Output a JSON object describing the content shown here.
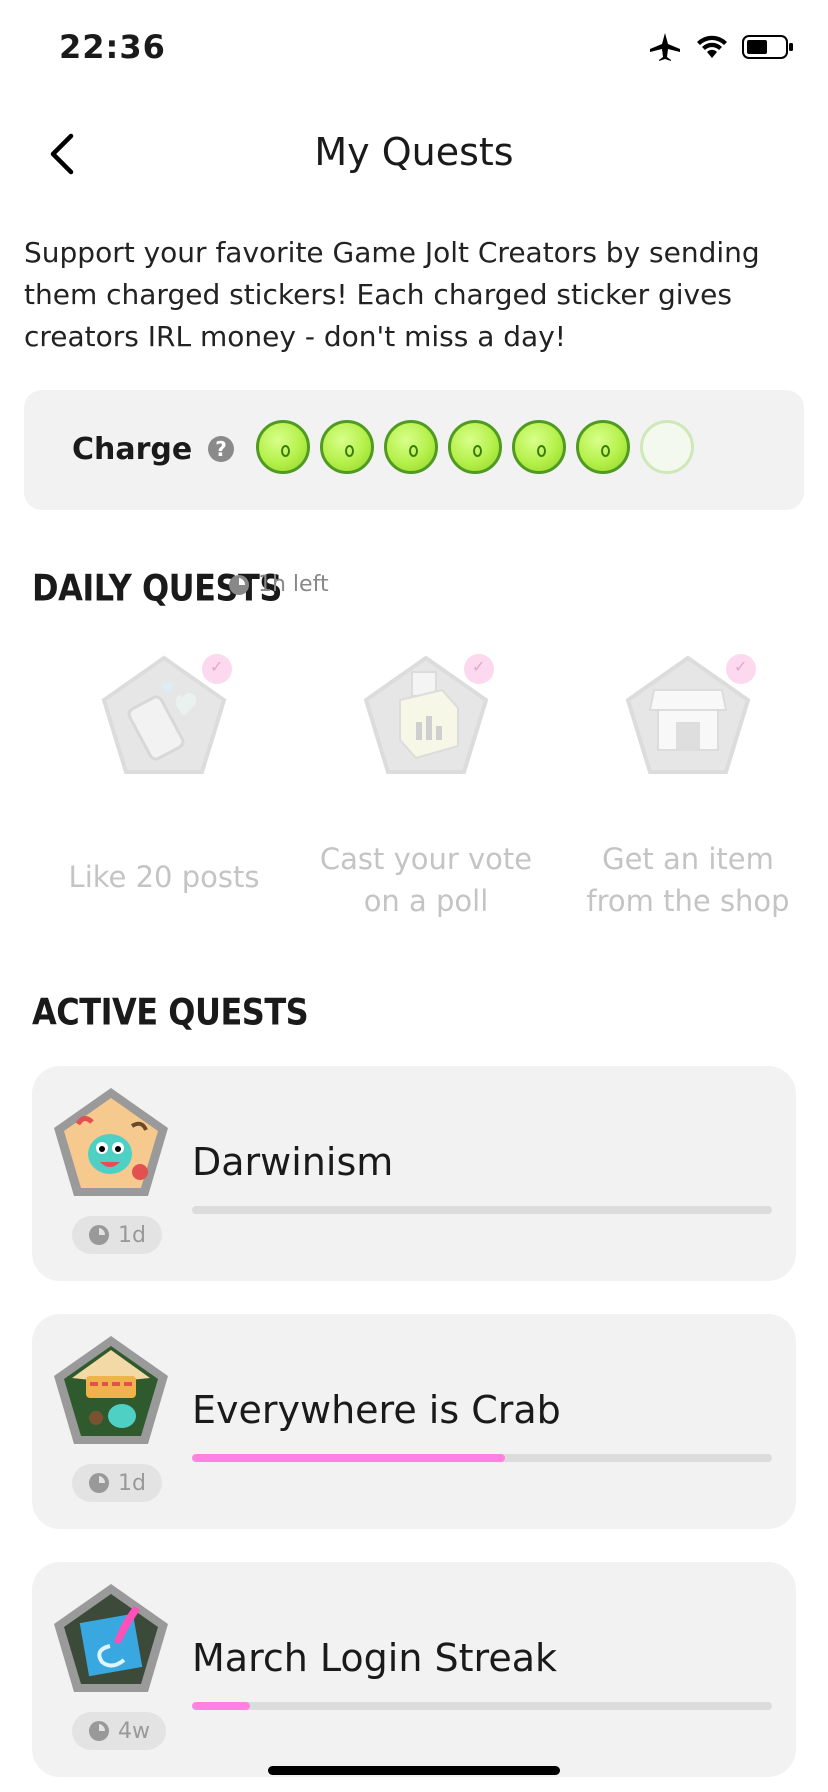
{
  "status_bar": {
    "time": "22:36",
    "icons": [
      "airplane-icon",
      "wifi-icon",
      "battery-icon"
    ]
  },
  "nav": {
    "title": "My Quests",
    "back_icon": "chevron-left-icon"
  },
  "intro": "Support your favorite Game Jolt Creators by sending them charged stickers! Each charged sticker gives creators IRL money - don't miss a day!",
  "charge": {
    "label": "Charge",
    "help_icon": "question-icon",
    "filled": 6,
    "total": 7
  },
  "daily": {
    "title": "DAILY QUESTS",
    "time_left": "1h left",
    "items": [
      {
        "label": "Like 20 posts",
        "icon": "like-phone-icon"
      },
      {
        "label": "Cast your vote on a poll",
        "icon": "ballot-box-icon"
      },
      {
        "label": "Get an item from the shop",
        "icon": "shop-icon"
      }
    ]
  },
  "active": {
    "title": "ACTIVE QUESTS",
    "quests": [
      {
        "title": "Darwinism",
        "time": "1d",
        "progress": 0.0
      },
      {
        "title": "Everywhere is Crab",
        "time": "1d",
        "progress": 0.54
      },
      {
        "title": "March Login Streak",
        "time": "4w",
        "progress": 0.1
      }
    ]
  },
  "colors": {
    "accent_progress": "#ff82e0",
    "charge_green": "#b5f04a",
    "card_bg": "#f2f2f2"
  }
}
